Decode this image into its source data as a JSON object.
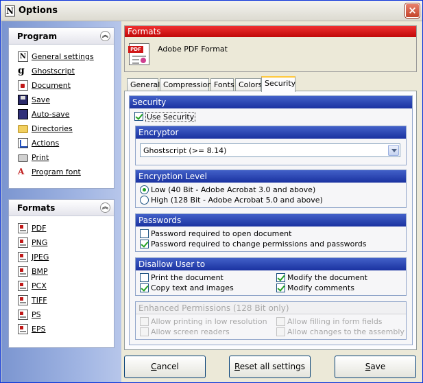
{
  "window": {
    "title": "Options",
    "close": "×"
  },
  "program_panel": {
    "title": "Program",
    "items": [
      {
        "label": "General settings",
        "icon": "n-logo-icon"
      },
      {
        "label": "Ghostscript",
        "icon": "ghostscript-icon"
      },
      {
        "label": "Document",
        "icon": "document-icon"
      },
      {
        "label": "Save",
        "icon": "floppy-disk-icon"
      },
      {
        "label": "Auto-save",
        "icon": "auto-save-icon"
      },
      {
        "label": "Directories",
        "icon": "folder-icon"
      },
      {
        "label": "Actions",
        "icon": "actions-icon"
      },
      {
        "label": "Print",
        "icon": "printer-icon"
      },
      {
        "label": "Program font",
        "icon": "font-icon"
      }
    ]
  },
  "formats_panel": {
    "title": "Formats",
    "items": [
      "PDF",
      "PNG",
      "JPEG",
      "BMP",
      "PCX",
      "TIFF",
      "PS",
      "EPS"
    ]
  },
  "formats_header": {
    "title": "Formats",
    "format_name": "Adobe PDF Format",
    "icon_tag": "PDF"
  },
  "tabs": [
    "General",
    "Compression",
    "Fonts",
    "Colors",
    "Security"
  ],
  "security": {
    "title": "Security",
    "use_security": "Use Security",
    "encryptor": {
      "title": "Encryptor",
      "value": "Ghostscript (>= 8.14)"
    },
    "encryption_level": {
      "title": "Encryption Level",
      "low": "Low (40 Bit - Adobe Acrobat 3.0 and above)",
      "high": "High (128 Bit - Adobe Acrobat 5.0 and above)"
    },
    "passwords": {
      "title": "Passwords",
      "open": "Password required to open document",
      "change": "Password required to change permissions and passwords"
    },
    "disallow": {
      "title": "Disallow User to",
      "print": "Print the document",
      "modify": "Modify the document",
      "copy": "Copy text and images",
      "comments": "Modify comments"
    },
    "enhanced": {
      "title": "Enhanced Permissions (128 Bit only)",
      "low_res": "Allow printing in low resolution",
      "form_fields": "Allow filling in form fields",
      "readers": "Allow screen readers",
      "assembly": "Allow changes to the assembly"
    }
  },
  "buttons": {
    "cancel": {
      "accel": "C",
      "rest": "ancel"
    },
    "reset": {
      "accel": "R",
      "rest": "eset all settings"
    },
    "save": {
      "accel": "S",
      "rest": "ave"
    }
  }
}
